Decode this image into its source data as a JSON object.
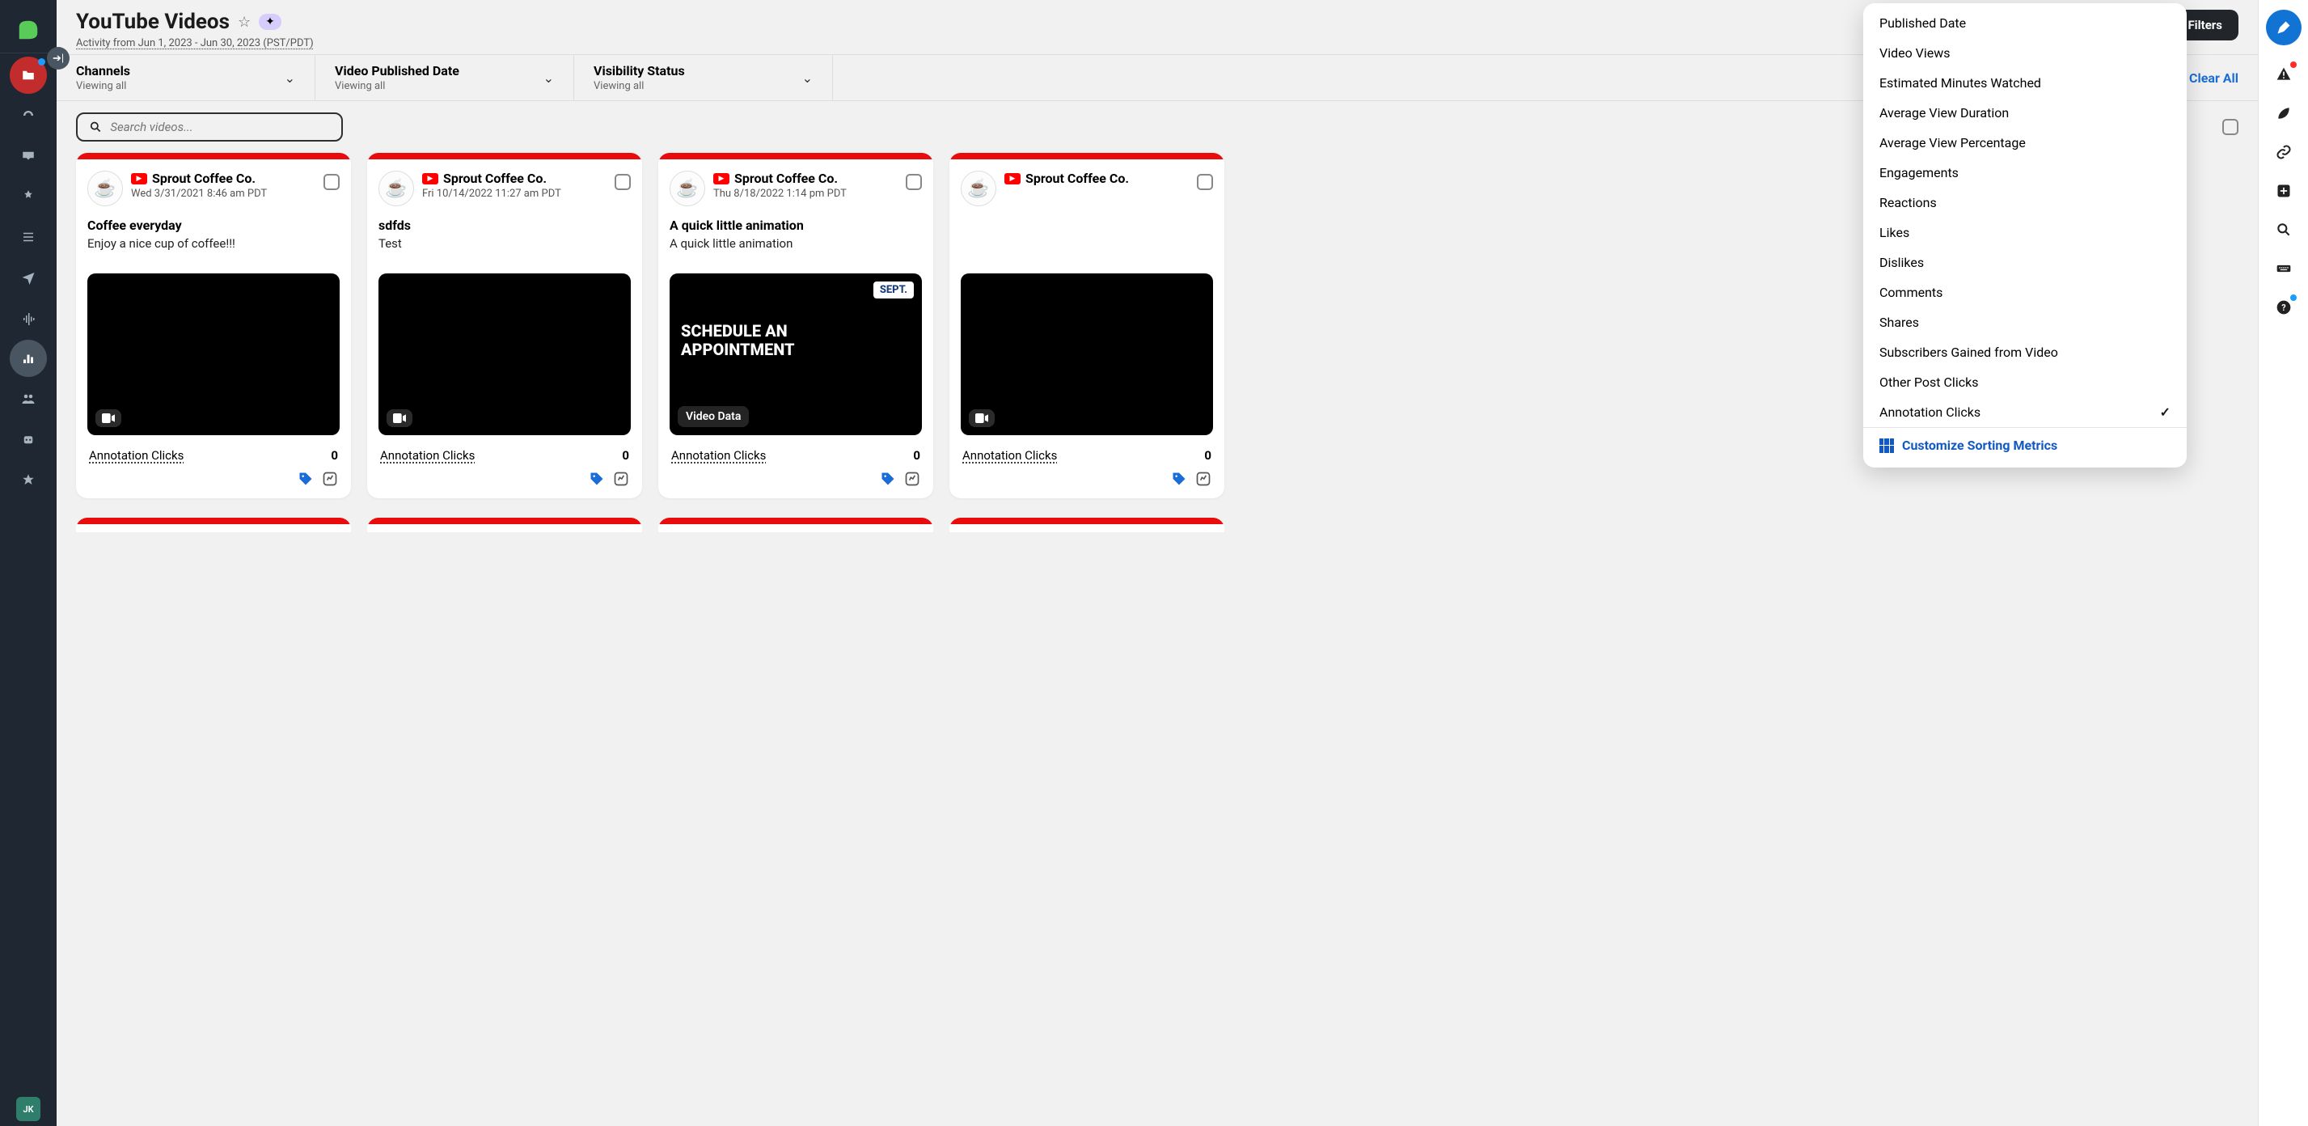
{
  "page": {
    "title": "YouTube Videos",
    "subtitle": "Activity from Jun 1, 2023 - Jun 30, 2023 (PST/PDT)",
    "date_range": "6/1/2023 – 6/30",
    "filters_button": "Filters",
    "search_placeholder": "Search videos..."
  },
  "filters": {
    "clear_all": "Clear All",
    "cells": [
      {
        "label": "Channels",
        "sub": "Viewing all"
      },
      {
        "label": "Video Published Date",
        "sub": "Viewing all"
      },
      {
        "label": "Visibility Status",
        "sub": "Viewing all"
      }
    ]
  },
  "dropdown": {
    "items": [
      "Published Date",
      "Video Views",
      "Estimated Minutes Watched",
      "Average View Duration",
      "Average View Percentage",
      "Engagements",
      "Reactions",
      "Likes",
      "Dislikes",
      "Comments",
      "Shares",
      "Subscribers Gained from Video",
      "Other Post Clicks",
      "Annotation Clicks"
    ],
    "selected_index": 13,
    "footer": "Customize Sorting Metrics"
  },
  "cards": [
    {
      "account": "Sprout Coffee Co.",
      "date": "Wed 3/31/2021 8:46 am PDT",
      "title": "Coffee everyday",
      "desc": "Enjoy a nice cup of coffee!!!",
      "metric_label": "Annotation Clicks",
      "metric_value": "0",
      "thumb_class": "t1",
      "video_badge": "icon"
    },
    {
      "account": "Sprout Coffee Co.",
      "date": "Fri 10/14/2022 11:27 am PDT",
      "title": "sdfds",
      "desc": "Test",
      "metric_label": "Annotation Clicks",
      "metric_value": "0",
      "thumb_class": "t2",
      "video_badge": "icon"
    },
    {
      "account": "Sprout Coffee Co.",
      "date": "Thu 8/18/2022 1:14 pm PDT",
      "title": "A quick little animation",
      "desc": "A quick little animation",
      "metric_label": "Annotation Clicks",
      "metric_value": "0",
      "thumb_class": "t3",
      "thumb_text": "SCHEDULE AN\nAPPOINTMENT",
      "thumb_corner": "SEPT.",
      "video_badge": "label",
      "video_badge_text": "Video Data"
    },
    {
      "account": "Sprout Coffee Co.",
      "date": "",
      "title": "",
      "desc": "",
      "metric_label": "Annotation Clicks",
      "metric_value": "0",
      "thumb_class": "t4",
      "video_badge": "icon"
    }
  ],
  "avatar_emoji": "☕",
  "user_initials": "JK"
}
